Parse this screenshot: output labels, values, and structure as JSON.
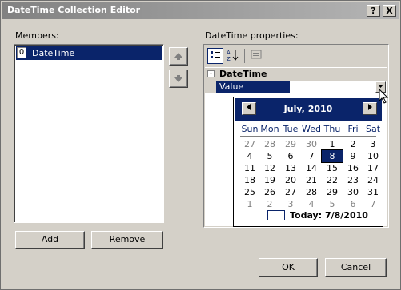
{
  "window": {
    "title": "DateTime Collection Editor",
    "help_label": "?",
    "close_label": "X"
  },
  "members": {
    "label": "Members:",
    "items": [
      {
        "index": "0",
        "label": "DateTime"
      }
    ],
    "up_icon": "arrow-up-icon",
    "down_icon": "arrow-down-icon",
    "add_label": "Add",
    "remove_label": "Remove"
  },
  "properties": {
    "label": "DateTime properties:",
    "toolbar_icons": [
      "categorized-icon",
      "alphabetical-icon",
      "property-pages-icon"
    ],
    "category": "DateTime",
    "collapse_symbol": "-",
    "property_name": "Value"
  },
  "calendar": {
    "month_label": "July, 2010",
    "prev_icon": "arrow-left-icon",
    "next_icon": "arrow-right-icon",
    "weekdays": [
      "Sun",
      "Mon",
      "Tue",
      "Wed",
      "Thu",
      "Fri",
      "Sat"
    ],
    "weeks": [
      [
        "27",
        "28",
        "29",
        "30",
        "1",
        "2",
        "3"
      ],
      [
        "4",
        "5",
        "6",
        "7",
        "8",
        "9",
        "10"
      ],
      [
        "11",
        "12",
        "13",
        "14",
        "15",
        "16",
        "17"
      ],
      [
        "18",
        "19",
        "20",
        "21",
        "22",
        "23",
        "24"
      ],
      [
        "25",
        "26",
        "27",
        "28",
        "29",
        "30",
        "31"
      ],
      [
        "1",
        "2",
        "3",
        "4",
        "5",
        "6",
        "7"
      ]
    ],
    "selected_day": "8",
    "today_text": "Today: 7/8/2010"
  },
  "footer": {
    "ok_label": "OK",
    "cancel_label": "Cancel"
  },
  "colors": {
    "selection": "#0a246a",
    "face": "#d4d0c8"
  }
}
